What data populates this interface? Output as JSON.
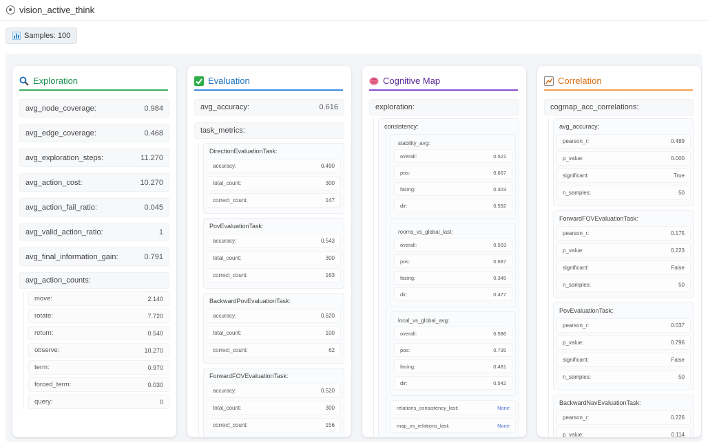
{
  "app": {
    "title": "vision_active_think"
  },
  "samples": {
    "label": "Samples: 100"
  },
  "colors": {
    "exploration": "#3ab05f",
    "evaluation": "#3b8de0",
    "cognitive_map": "#8a4fd0",
    "correlation": "#f0a050"
  },
  "exploration": {
    "title": "Exploration",
    "icon": "magnifier-icon",
    "rows": [
      {
        "k": "avg_node_coverage:",
        "v": "0.984"
      },
      {
        "k": "avg_edge_coverage:",
        "v": "0.468"
      },
      {
        "k": "avg_exploration_steps:",
        "v": "11.270"
      },
      {
        "k": "avg_action_cost:",
        "v": "10.270"
      },
      {
        "k": "avg_action_fail_ratio:",
        "v": "0.045"
      },
      {
        "k": "avg_valid_action_ratio:",
        "v": "1"
      },
      {
        "k": "avg_final_information_gain:",
        "v": "0.791"
      }
    ],
    "action_counts_label": "avg_action_counts:",
    "action_counts": [
      {
        "k": "move:",
        "v": "2.140"
      },
      {
        "k": "rotate:",
        "v": "7.720"
      },
      {
        "k": "return:",
        "v": "0.540"
      },
      {
        "k": "observe:",
        "v": "10.270"
      },
      {
        "k": "term:",
        "v": "0.970"
      },
      {
        "k": "forced_term:",
        "v": "0.030"
      },
      {
        "k": "query:",
        "v": "0"
      }
    ]
  },
  "evaluation": {
    "title": "Evaluation",
    "icon": "checkbox-icon",
    "avg_accuracy": {
      "k": "avg_accuracy:",
      "v": "0.616"
    },
    "task_metrics_label": "task_metrics:",
    "tasks": [
      {
        "name": "DirectionEvaluationTask:",
        "rows": [
          {
            "k": "accuracy:",
            "v": "0.490"
          },
          {
            "k": "total_count:",
            "v": "300"
          },
          {
            "k": "correct_count:",
            "v": "147"
          }
        ]
      },
      {
        "name": "PovEvaluationTask:",
        "rows": [
          {
            "k": "accuracy:",
            "v": "0.543"
          },
          {
            "k": "total_count:",
            "v": "300"
          },
          {
            "k": "correct_count:",
            "v": "163"
          }
        ]
      },
      {
        "name": "BackwardPovEvaluationTask:",
        "rows": [
          {
            "k": "accuracy:",
            "v": "0.620"
          },
          {
            "k": "total_count:",
            "v": "100"
          },
          {
            "k": "correct_count:",
            "v": "62"
          }
        ]
      },
      {
        "name": "ForwardFOVEvaluationTask:",
        "rows": [
          {
            "k": "accuracy:",
            "v": "0.520"
          },
          {
            "k": "total_count:",
            "v": "300"
          },
          {
            "k": "correct_count:",
            "v": "156"
          }
        ]
      }
    ]
  },
  "cognitive_map": {
    "title": "Cognitive Map",
    "icon": "brain-icon",
    "exploration_label": "exploration:",
    "consistency_label": "consistency:",
    "groups": [
      {
        "name": "stability_avg:",
        "rows": [
          {
            "k": "overall:",
            "v": "0.521"
          },
          {
            "k": "pos:",
            "v": "0.667"
          },
          {
            "k": "facing:",
            "v": "0.303"
          },
          {
            "k": "dir:",
            "v": "0.592"
          }
        ]
      },
      {
        "name": "rooms_vs_global_last:",
        "rows": [
          {
            "k": "overall:",
            "v": "0.503"
          },
          {
            "k": "pos:",
            "v": "0.687"
          },
          {
            "k": "facing:",
            "v": "0.345"
          },
          {
            "k": "dir:",
            "v": "0.477"
          }
        ]
      },
      {
        "name": "local_vs_global_avg:",
        "rows": [
          {
            "k": "overall:",
            "v": "0.586"
          },
          {
            "k": "pos:",
            "v": "0.735"
          },
          {
            "k": "facing:",
            "v": "0.481"
          },
          {
            "k": "dir:",
            "v": "0.542"
          }
        ]
      }
    ],
    "extra_rows": [
      {
        "k": "relations_consistency_last:",
        "v": "None"
      },
      {
        "k": "map_vs_relations_last:",
        "v": "None"
      }
    ]
  },
  "correlation": {
    "title": "Correlation",
    "icon": "chart-box-icon",
    "label": "cogmap_acc_correlations:",
    "groups": [
      {
        "name": "avg_accuracy:",
        "rows": [
          {
            "k": "pearson_r:",
            "v": "0.489"
          },
          {
            "k": "p_value:",
            "v": "0.000"
          },
          {
            "k": "significant:",
            "v": "True"
          },
          {
            "k": "n_samples:",
            "v": "50"
          }
        ]
      },
      {
        "name": "ForwardFOVEvaluationTask:",
        "rows": [
          {
            "k": "pearson_r:",
            "v": "0.175"
          },
          {
            "k": "p_value:",
            "v": "0.223"
          },
          {
            "k": "significant:",
            "v": "False"
          },
          {
            "k": "n_samples:",
            "v": "50"
          }
        ]
      },
      {
        "name": "PovEvaluationTask:",
        "rows": [
          {
            "k": "pearson_r:",
            "v": "0.037"
          },
          {
            "k": "p_value:",
            "v": "0.796"
          },
          {
            "k": "significant:",
            "v": "False"
          },
          {
            "k": "n_samples:",
            "v": "50"
          }
        ]
      },
      {
        "name": "BackwardNavEvaluationTask:",
        "rows": [
          {
            "k": "pearson_r:",
            "v": "0.226"
          },
          {
            "k": "p_value:",
            "v": "0.114"
          }
        ]
      }
    ]
  }
}
